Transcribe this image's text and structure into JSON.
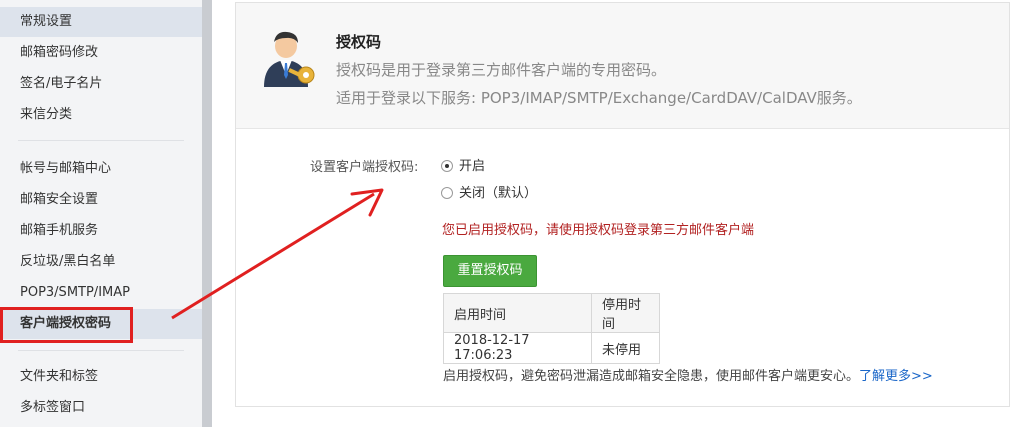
{
  "sidebar": {
    "group1": [
      {
        "label": "常规设置"
      },
      {
        "label": "邮箱密码修改"
      },
      {
        "label": "签名/电子名片"
      },
      {
        "label": "来信分类"
      }
    ],
    "group2": [
      {
        "label": "帐号与邮箱中心"
      },
      {
        "label": "邮箱安全设置"
      },
      {
        "label": "邮箱手机服务"
      },
      {
        "label": "反垃圾/黑白名单"
      },
      {
        "label": "POP3/SMTP/IMAP"
      },
      {
        "label": "客户端授权密码"
      }
    ],
    "group3": [
      {
        "label": "文件夹和标签"
      },
      {
        "label": "多标签窗口"
      }
    ]
  },
  "header": {
    "title": "授权码",
    "description": "授权码是用于登录第三方邮件客户端的专用密码。",
    "services": "适用于登录以下服务: POP3/IMAP/SMTP/Exchange/CardDAV/CalDAV服务。"
  },
  "form": {
    "label": "设置客户端授权码:",
    "option_on": "开启",
    "option_off": "关闭（默认）",
    "selected": "开启",
    "notice": "您已启用授权码，请使用授权码登录第三方邮件客户端",
    "reset_button": "重置授权码"
  },
  "table": {
    "headers": [
      "启用时间",
      "停用时间"
    ],
    "rows": [
      [
        "2018-12-17 17:06:23",
        "未停用"
      ]
    ]
  },
  "footer": {
    "text": "启用授权码，避免密码泄漏造成邮箱安全隐患，使用邮件客户端更安心。",
    "link": "了解更多>>"
  },
  "colors": {
    "annotation_red": "#e02020",
    "button_green": "#4aa93f",
    "notice_red": "#b22222",
    "link_blue": "#1a66c8"
  }
}
